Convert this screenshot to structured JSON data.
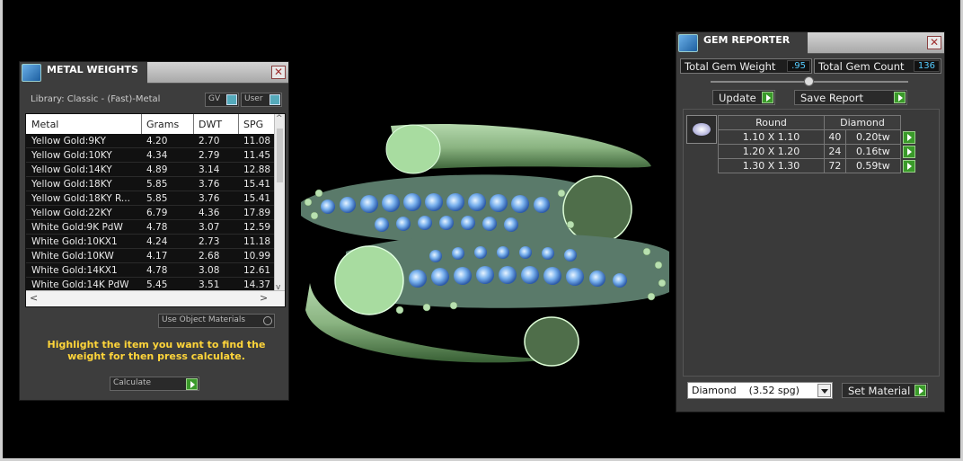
{
  "metal_weights": {
    "title": "METAL WEIGHTS",
    "library": "Library: Classic - (Fast)-Metal",
    "gv_label": "GV",
    "user_label": "User",
    "columns": [
      "Metal",
      "Grams",
      "DWT",
      "SPG"
    ],
    "rows": [
      [
        "Yellow Gold:9KY",
        "4.20",
        "2.70",
        "11.08"
      ],
      [
        "Yellow Gold:10KY",
        "4.34",
        "2.79",
        "11.45"
      ],
      [
        "Yellow Gold:14KY",
        "4.89",
        "3.14",
        "12.88"
      ],
      [
        "Yellow Gold:18KY",
        "5.85",
        "3.76",
        "15.41"
      ],
      [
        "Yellow Gold:18KY R...",
        "5.85",
        "3.76",
        "15.41"
      ],
      [
        "Yellow Gold:22KY",
        "6.79",
        "4.36",
        "17.89"
      ],
      [
        "White Gold:9K PdW",
        "4.78",
        "3.07",
        "12.59"
      ],
      [
        "White Gold:10KX1",
        "4.24",
        "2.73",
        "11.18"
      ],
      [
        "White Gold:10KW",
        "4.17",
        "2.68",
        "10.99"
      ],
      [
        "White Gold:14KX1",
        "4.78",
        "3.08",
        "12.61"
      ],
      [
        "White Gold:14K PdW",
        "5.45",
        "3.51",
        "14.37"
      ]
    ],
    "use_object_materials": "Use Object Materials",
    "hint": "Highlight the item you want to find the weight for then press calculate.",
    "calculate_label": "Calculate"
  },
  "gem_reporter": {
    "title": "GEM REPORTER",
    "total_gem_weight_label": "Total Gem Weight",
    "total_gem_weight": ".95",
    "total_gem_count_label": "Total Gem Count",
    "total_gem_count": "136",
    "update_label": "Update",
    "save_report_label": "Save Report",
    "shape": "Round",
    "material": "Diamond",
    "gems": [
      {
        "size": "1.10 X 1.10",
        "count": "40",
        "weight": "0.20tw"
      },
      {
        "size": "1.20 X 1.20",
        "count": "24",
        "weight": "0.16tw"
      },
      {
        "size": "1.30 X 1.30",
        "count": "72",
        "weight": "0.59tw"
      }
    ],
    "material_select": "Diamond    (3.52 spg)",
    "set_material_label": "Set Material"
  }
}
